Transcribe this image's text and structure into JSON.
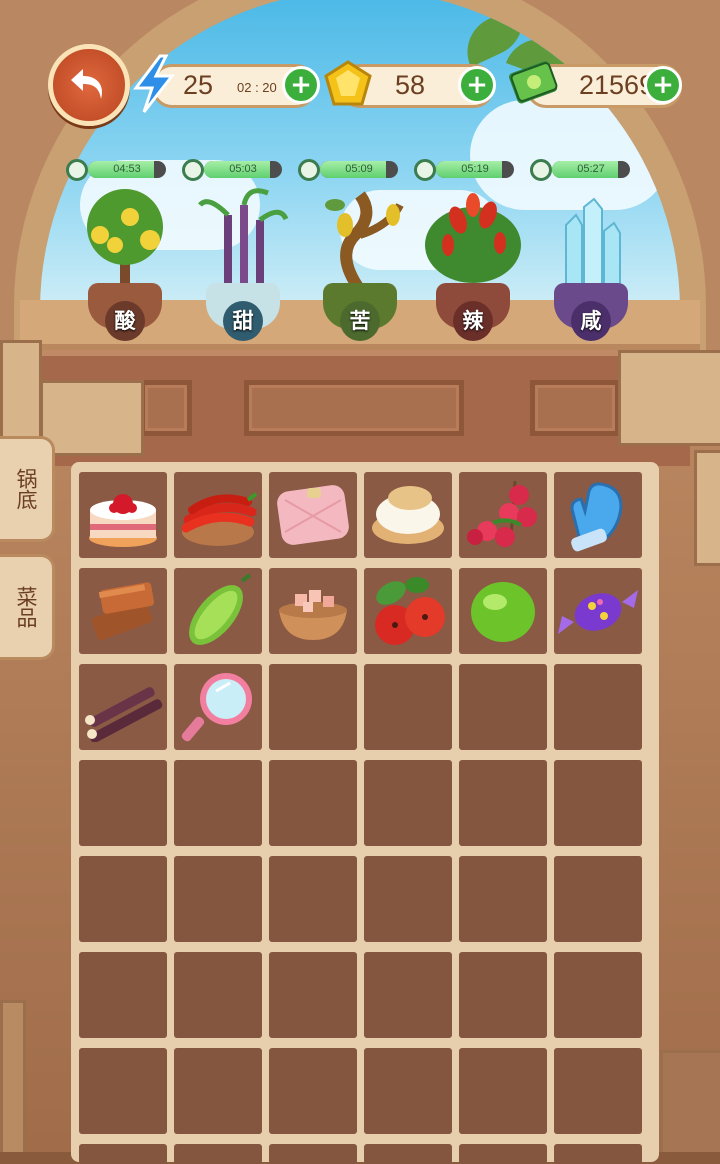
{
  "top_bar": {
    "energy": {
      "value": "25",
      "timer": "02 : 20",
      "icon": "lightning-icon"
    },
    "gems": {
      "value": "58",
      "icon": "gem-icon"
    },
    "money": {
      "value": "21569",
      "icon": "cash-icon"
    },
    "plus_label": "+"
  },
  "plants": [
    {
      "label": "酸",
      "timer": "04:53",
      "progress": 0.85,
      "name": "lemon-tree",
      "badge_color": "#6b3a2a"
    },
    {
      "label": "甜",
      "timer": "05:03",
      "progress": 0.85,
      "name": "sugarcane-plant",
      "badge_color": "#2f5c6e"
    },
    {
      "label": "苦",
      "timer": "05:09",
      "progress": 0.85,
      "name": "bitter-melon-plant",
      "badge_color": "#4c6a2e"
    },
    {
      "label": "辣",
      "timer": "05:19",
      "progress": 0.85,
      "name": "chili-plant",
      "badge_color": "#6b2f2a"
    },
    {
      "label": "咸",
      "timer": "05:27",
      "progress": 0.85,
      "name": "salt-crystal-plant",
      "badge_color": "#4b2f6a"
    }
  ],
  "side_tabs": [
    {
      "label": "锅底"
    },
    {
      "label": "菜品"
    }
  ],
  "inventory": {
    "items": [
      "cake-icon",
      "chili-peppers-icon",
      "pink-cushion-icon",
      "cream-puff-icon",
      "lychee-icon",
      "blue-mitten-icon",
      "brown-sugar-icon",
      "bitter-melon-icon",
      "pink-salt-bowl-icon",
      "hawthorn-icon",
      "lime-icon",
      "candy-icon",
      "sugarcane-icon",
      "pink-mirror-icon"
    ]
  }
}
